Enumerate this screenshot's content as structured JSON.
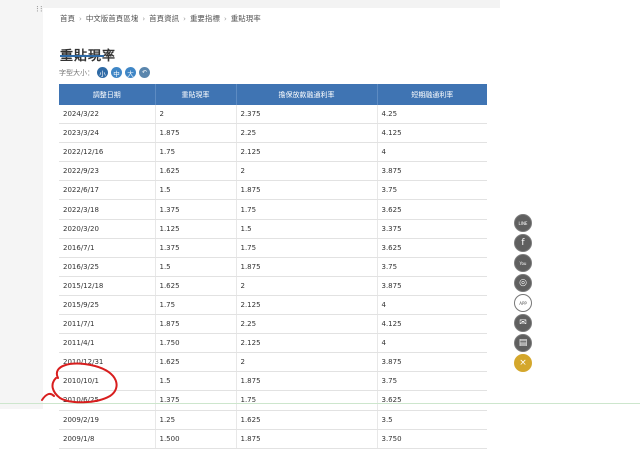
{
  "breadcrumb": [
    "首頁",
    "中文版首頁區塊",
    "首頁資訊",
    "重要指標",
    "重貼現率"
  ],
  "page_title": "重貼現率",
  "font_size": {
    "label": "字型大小：",
    "small": "小",
    "medium": "中",
    "large": "大",
    "back": "↶"
  },
  "table": {
    "headers": [
      "調整日期",
      "重貼現率",
      "擔保放款融通利率",
      "短期融通利率"
    ],
    "rows": [
      [
        "2024/3/22",
        "2",
        "2.375",
        "4.25"
      ],
      [
        "2023/3/24",
        "1.875",
        "2.25",
        "4.125"
      ],
      [
        "2022/12/16",
        "1.75",
        "2.125",
        "4"
      ],
      [
        "2022/9/23",
        "1.625",
        "2",
        "3.875"
      ],
      [
        "2022/6/17",
        "1.5",
        "1.875",
        "3.75"
      ],
      [
        "2022/3/18",
        "1.375",
        "1.75",
        "3.625"
      ],
      [
        "2020/3/20",
        "1.125",
        "1.5",
        "3.375"
      ],
      [
        "2016/7/1",
        "1.375",
        "1.75",
        "3.625"
      ],
      [
        "2016/3/25",
        "1.5",
        "1.875",
        "3.75"
      ],
      [
        "2015/12/18",
        "1.625",
        "2",
        "3.875"
      ],
      [
        "2015/9/25",
        "1.75",
        "2.125",
        "4"
      ],
      [
        "2011/7/1",
        "1.875",
        "2.25",
        "4.125"
      ],
      [
        "2011/4/1",
        "1.750",
        "2.125",
        "4"
      ],
      [
        "2010/12/31",
        "1.625",
        "2",
        "3.875"
      ],
      [
        "2010/10/1",
        "1.5",
        "1.875",
        "3.75"
      ],
      [
        "2010/6/25",
        "1.375",
        "1.75",
        "3.625"
      ],
      [
        "2009/2/19",
        "1.25",
        "1.625",
        "3.5"
      ],
      [
        "2009/1/8",
        "1.500",
        "1.875",
        "3.750"
      ]
    ]
  },
  "side_icons": [
    {
      "name": "line",
      "glyph": "LINE"
    },
    {
      "name": "facebook",
      "glyph": "f"
    },
    {
      "name": "youtube",
      "glyph": "You"
    },
    {
      "name": "instagram",
      "glyph": "◎"
    },
    {
      "name": "app",
      "glyph": "APP"
    },
    {
      "name": "mail",
      "glyph": "✉"
    },
    {
      "name": "document",
      "glyph": "▤"
    },
    {
      "name": "close",
      "glyph": "×"
    }
  ],
  "colors": {
    "header_blue": "#3f74b3",
    "title_underline": "#2f6aa5",
    "annotation_red": "#d81e1e",
    "close_gold": "#d4a72c"
  }
}
